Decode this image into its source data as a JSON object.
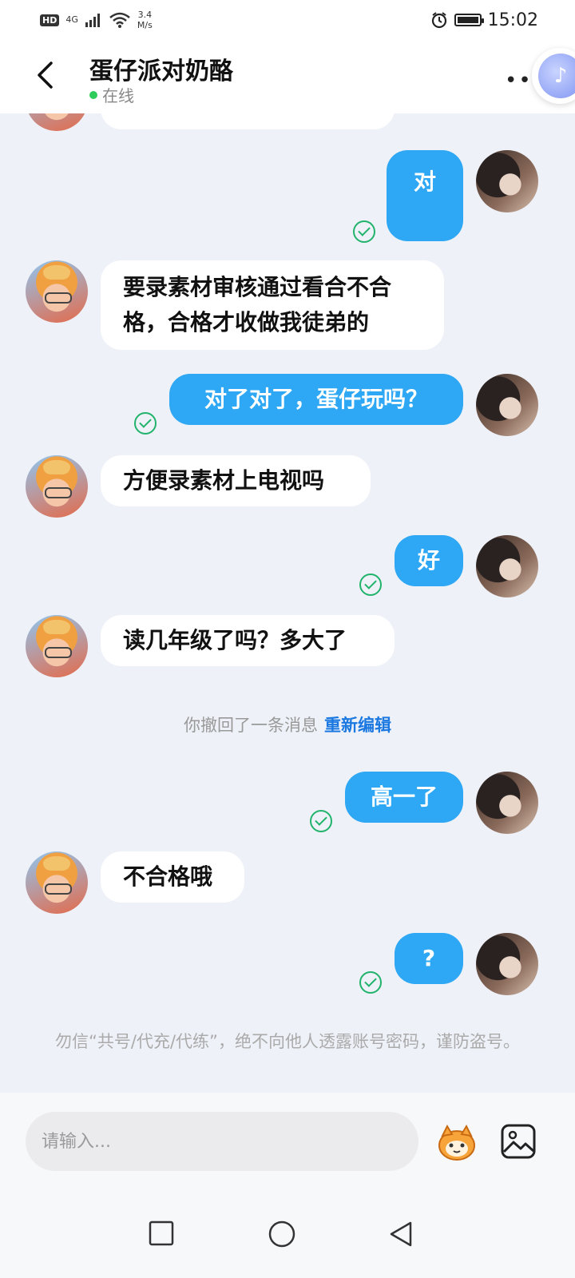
{
  "status_bar": {
    "hd": "HD",
    "network": "4G",
    "speed_top": "3.4",
    "speed_bottom": "M/s",
    "time": "15:02"
  },
  "header": {
    "title": "蛋仔派对奶酪",
    "status": "在线",
    "more": "•••"
  },
  "messages": [
    {
      "side": "out",
      "text": "对"
    },
    {
      "side": "in",
      "text": "要录素材审核通过看合不合格，合格才收做我徒弟的"
    },
    {
      "side": "out",
      "text": "对了对了，蛋仔玩吗？"
    },
    {
      "side": "in",
      "text": "方便录素材上电视吗"
    },
    {
      "side": "out",
      "text": "好"
    },
    {
      "side": "in",
      "text": "读几年级了吗？多大了"
    },
    {
      "side": "out",
      "text": "高一了"
    },
    {
      "side": "in",
      "text": "不合格哦"
    },
    {
      "side": "out",
      "text": "?"
    }
  ],
  "recall": {
    "text": "你撤回了一条消息",
    "action": "重新编辑"
  },
  "notice": "勿信“共号/代充/代练”，绝不向他人透露账号密码，谨防盗号。",
  "input": {
    "placeholder": "请输入..."
  },
  "colors": {
    "outgoing_bubble": "#2ea7f5",
    "incoming_bubble": "#ffffff",
    "read_check": "#21b36b",
    "link": "#1a78e0",
    "online": "#2ecc5a"
  }
}
